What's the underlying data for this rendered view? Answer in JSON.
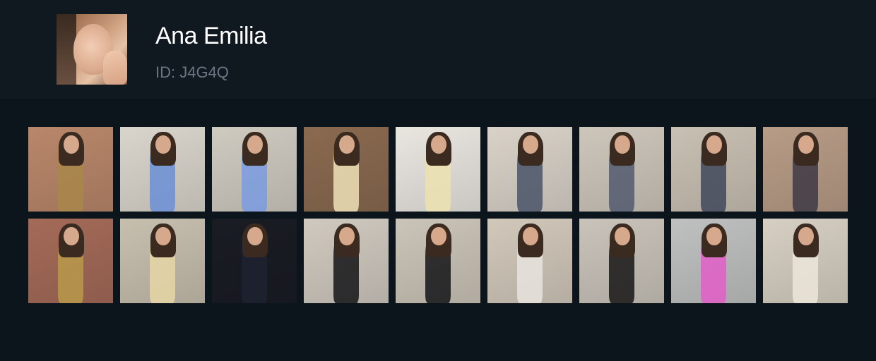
{
  "profile": {
    "name": "Ana Emilia",
    "id_text": "ID: J4G4Q"
  },
  "thumbnails": [
    {
      "bg": "#b9876a",
      "top": "#a8874a"
    },
    {
      "bg": "#d9d5cc",
      "top": "#6b8fd6"
    },
    {
      "bg": "#cfcac0",
      "top": "#7a9be0"
    },
    {
      "bg": "#8a6a50",
      "top": "#efe2b8"
    },
    {
      "bg": "#e9e6e0",
      "top": "#ece2b0"
    },
    {
      "bg": "#d8d2c8",
      "top": "#4a5468"
    },
    {
      "bg": "#cdc6bb",
      "top": "#525a6e"
    },
    {
      "bg": "#c8c0b2",
      "top": "#40485a"
    },
    {
      "bg": "#b79c86",
      "top": "#3e3a44"
    },
    {
      "bg": "#a46a58",
      "top": "#b89a4a"
    },
    {
      "bg": "#c7bfae",
      "top": "#e6d6a6"
    },
    {
      "bg": "#1a1c24",
      "top": "#1e2230"
    },
    {
      "bg": "#cfc9bf",
      "top": "#141418"
    },
    {
      "bg": "#cbc4b8",
      "top": "#141418"
    },
    {
      "bg": "#d1c8ba",
      "top": "#e8e4de"
    },
    {
      "bg": "#c9c3ba",
      "top": "#161616"
    },
    {
      "bg": "#bfc1c0",
      "top": "#e25ec8"
    },
    {
      "bg": "#d6cfc2",
      "top": "#ece6da"
    }
  ]
}
